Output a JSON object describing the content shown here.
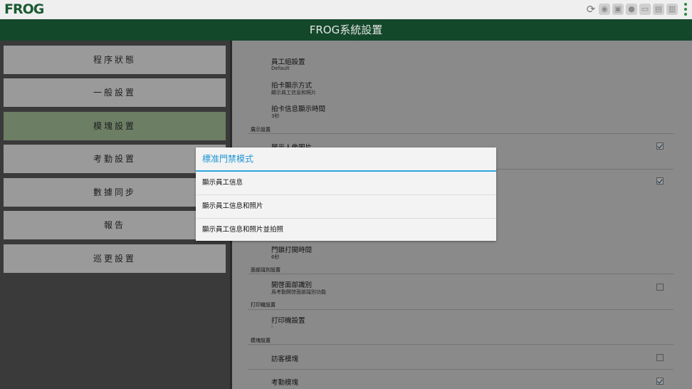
{
  "topbar": {
    "logo": "FROG",
    "icons": [
      "sync-icon",
      "fingerprint-icon",
      "lock-icon",
      "bulb-icon",
      "monitor-icon",
      "card-icon",
      "book-icon",
      "more-vert-icon"
    ]
  },
  "window_title": "FROG系統設置",
  "sidebar": {
    "items": [
      {
        "label": "程序狀態"
      },
      {
        "label": "一般設置"
      },
      {
        "label": "模塊設置",
        "selected": true
      },
      {
        "label": "考勤設置"
      },
      {
        "label": "數據同步"
      },
      {
        "label": "報告"
      },
      {
        "label": "巡更設置"
      }
    ]
  },
  "settings": {
    "employee_group": {
      "title": "員工組設置",
      "value": "Default"
    },
    "card_display_mode": {
      "title": "拍卡顯示方式",
      "value": "顯示員工信息和照片"
    },
    "card_display_time": {
      "title": "拍卡信息顯示時間",
      "value": "3秒"
    },
    "display_section": "展示設置",
    "show_avatar": {
      "title": "展示人像圖片",
      "checked": true
    },
    "row_checked_2": {
      "checked": true
    },
    "door_open_time": {
      "title": "門鎖打開時間",
      "value": "6秒"
    },
    "face_section": "面部識別設置",
    "face_recognition": {
      "title": "開啓面部識別",
      "value": "爲考勤開啓面部識別功能",
      "checked": false
    },
    "printer_section": "打印機設置",
    "printer": {
      "title": "打印機設置",
      "value": "-"
    },
    "module_section": "模塊設置",
    "visitor_module": {
      "title": "訪客模塊",
      "checked": false
    },
    "attendance_module": {
      "title": "考勤模塊",
      "checked": true
    }
  },
  "dialog": {
    "title": "標准門禁模式",
    "options": [
      "顯示員工信息",
      "顯示員工信息和照片",
      "顯示員工信息和照片並拍照"
    ]
  },
  "colors": {
    "brand_green": "#14482b",
    "accent_blue": "#2196d3",
    "selected_item": "#6c7f65"
  }
}
